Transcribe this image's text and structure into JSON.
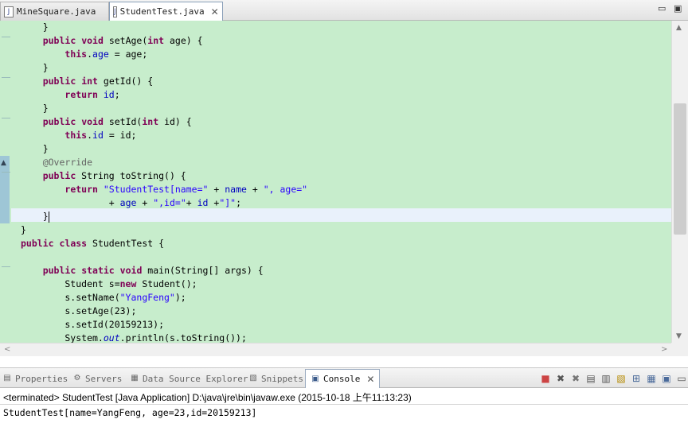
{
  "editor_tabs": [
    {
      "label": "MineSquare.java",
      "icon": "java-file-icon",
      "active": false
    },
    {
      "label": "StudentTest.java",
      "icon": "java-file-icon",
      "active": true,
      "close_glyph": "✕"
    }
  ],
  "window_controls": {
    "minimize_glyph": "▭",
    "maximize_glyph": "▣"
  },
  "code": {
    "lines": [
      [
        {
          "t": "    }"
        }
      ],
      [
        {
          "t": "    "
        },
        {
          "t": "public",
          "c": "kw"
        },
        {
          "t": " "
        },
        {
          "t": "void",
          "c": "kw"
        },
        {
          "t": " setAge("
        },
        {
          "t": "int",
          "c": "kw"
        },
        {
          "t": " age) {"
        }
      ],
      [
        {
          "t": "        "
        },
        {
          "t": "this",
          "c": "kw"
        },
        {
          "t": "."
        },
        {
          "t": "age",
          "c": "fld"
        },
        {
          "t": " = age;"
        }
      ],
      [
        {
          "t": "    }"
        }
      ],
      [
        {
          "t": "    "
        },
        {
          "t": "public",
          "c": "kw"
        },
        {
          "t": " "
        },
        {
          "t": "int",
          "c": "kw"
        },
        {
          "t": " getId() {"
        }
      ],
      [
        {
          "t": "        "
        },
        {
          "t": "return",
          "c": "kw"
        },
        {
          "t": " "
        },
        {
          "t": "id",
          "c": "fld"
        },
        {
          "t": ";"
        }
      ],
      [
        {
          "t": "    }"
        }
      ],
      [
        {
          "t": "    "
        },
        {
          "t": "public",
          "c": "kw"
        },
        {
          "t": " "
        },
        {
          "t": "void",
          "c": "kw"
        },
        {
          "t": " setId("
        },
        {
          "t": "int",
          "c": "kw"
        },
        {
          "t": " id) {"
        }
      ],
      [
        {
          "t": "        "
        },
        {
          "t": "this",
          "c": "kw"
        },
        {
          "t": "."
        },
        {
          "t": "id",
          "c": "fld"
        },
        {
          "t": " = id;"
        }
      ],
      [
        {
          "t": "    }"
        }
      ],
      [
        {
          "t": "    "
        },
        {
          "t": "@Override",
          "c": "ann"
        }
      ],
      [
        {
          "t": "    "
        },
        {
          "t": "public",
          "c": "kw"
        },
        {
          "t": " String toString() {"
        }
      ],
      [
        {
          "t": "        "
        },
        {
          "t": "return",
          "c": "kw"
        },
        {
          "t": " "
        },
        {
          "t": "\"StudentTest[name=\"",
          "c": "str"
        },
        {
          "t": " + "
        },
        {
          "t": "name",
          "c": "fld"
        },
        {
          "t": " + "
        },
        {
          "t": "\", age=\"",
          "c": "str"
        }
      ],
      [
        {
          "t": "                "
        },
        {
          "t": "+ "
        },
        {
          "t": "age",
          "c": "fld"
        },
        {
          "t": " + "
        },
        {
          "t": "\",id=\"",
          "c": "str"
        },
        {
          "t": "+ "
        },
        {
          "t": "id",
          "c": "fld"
        },
        {
          "t": " +"
        },
        {
          "t": "\"]\"",
          "c": "str"
        },
        {
          "t": ";"
        }
      ],
      [
        {
          "t": "    }"
        },
        {
          "caret": true
        }
      ],
      [
        {
          "t": "}"
        }
      ],
      [
        {
          "t": "public",
          "c": "kw"
        },
        {
          "t": " "
        },
        {
          "t": "class",
          "c": "kw"
        },
        {
          "t": " StudentTest {"
        }
      ],
      [
        {
          "t": ""
        }
      ],
      [
        {
          "t": "    "
        },
        {
          "t": "public",
          "c": "kw"
        },
        {
          "t": " "
        },
        {
          "t": "static",
          "c": "kw"
        },
        {
          "t": " "
        },
        {
          "t": "void",
          "c": "kw"
        },
        {
          "t": " main(String[] args) {"
        }
      ],
      [
        {
          "t": "        Student s="
        },
        {
          "t": "new",
          "c": "kw"
        },
        {
          "t": " Student();"
        }
      ],
      [
        {
          "t": "        s.setName("
        },
        {
          "t": "\"YangFeng\"",
          "c": "str"
        },
        {
          "t": ");"
        }
      ],
      [
        {
          "t": "        s.setAge(23);"
        }
      ],
      [
        {
          "t": "        s.setId(20159213);"
        }
      ],
      [
        {
          "t": "        System."
        },
        {
          "t": "out",
          "c": "stat"
        },
        {
          "t": ".println(s.toString());"
        }
      ]
    ]
  },
  "view_tabs": [
    {
      "label": "Properties",
      "icon": "properties-icon",
      "glyph": "▤",
      "active": false
    },
    {
      "label": "Servers",
      "icon": "servers-icon",
      "glyph": "⚙",
      "active": false
    },
    {
      "label": "Data Source Explorer",
      "icon": "data-source-icon",
      "glyph": "▦",
      "active": false
    },
    {
      "label": "Snippets",
      "icon": "snippets-icon",
      "glyph": "▧",
      "active": false
    },
    {
      "label": "Console",
      "icon": "console-icon",
      "glyph": "▣",
      "active": true,
      "close_glyph": "✕"
    }
  ],
  "console_toolbar": [
    {
      "name": "terminate-icon",
      "glyph": "■",
      "color": "#c44"
    },
    {
      "name": "remove-launch-icon",
      "glyph": "✖",
      "color": "#555"
    },
    {
      "name": "remove-all-terminated-icon",
      "glyph": "✖",
      "color": "#777"
    },
    {
      "name": "clear-console-icon",
      "glyph": "▤",
      "color": "#555"
    },
    {
      "name": "scroll-lock-icon",
      "glyph": "▥",
      "color": "#555"
    },
    {
      "name": "word-wrap-icon",
      "glyph": "▧",
      "color": "#b58a00"
    },
    {
      "name": "pin-console-icon",
      "glyph": "⊞",
      "color": "#4a6a9a"
    },
    {
      "name": "display-selected-console-icon",
      "glyph": "▦",
      "color": "#4a6a9a"
    },
    {
      "name": "open-console-icon",
      "glyph": "▣",
      "color": "#4a6a9a"
    },
    {
      "name": "view-minimize-icon",
      "glyph": "▭",
      "color": "#555"
    }
  ],
  "console": {
    "status": "<terminated> StudentTest [Java Application] D:\\java\\jre\\bin\\javaw.exe (2015-10-18 上午11:13:23)",
    "output": "StudentTest[name=YangFeng, age=23,id=20159213]"
  },
  "colors": {
    "editor_background": "#c7edcc",
    "keyword": "#7f0055",
    "field": "#0000c0",
    "string": "#2a00ff",
    "annotation": "#646464"
  }
}
